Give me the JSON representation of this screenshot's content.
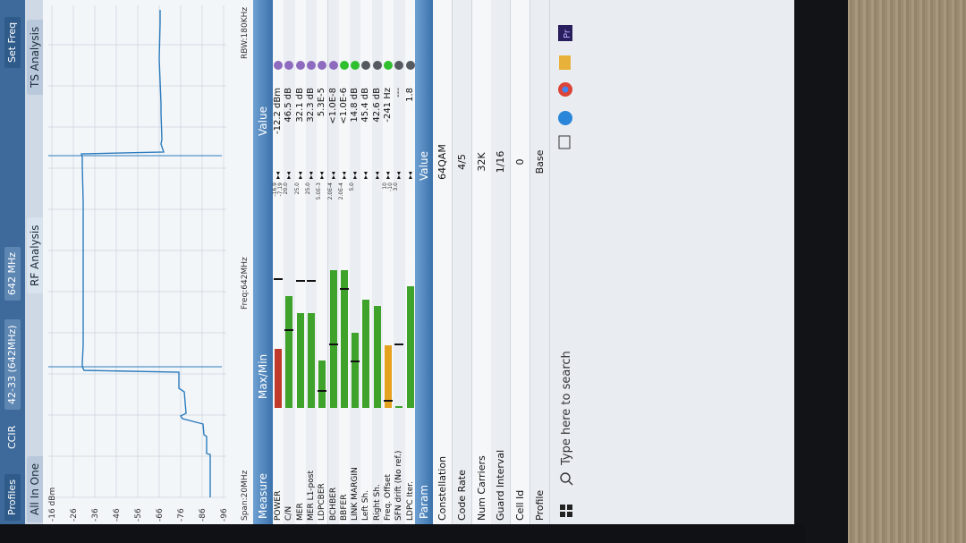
{
  "toolbar": {
    "profiles_label": "Profiles",
    "standard_label": "CCIR",
    "channel_label": "42-33 (642MHz)",
    "freq_label": "642 MHz",
    "set_freq_label": "Set Freq"
  },
  "tabs": [
    {
      "label": "All In One"
    },
    {
      "label": "RF Analysis"
    },
    {
      "label": "TS Analysis"
    }
  ],
  "spectrum": {
    "db_labels": [
      "-16 dBm",
      "-26",
      "-36",
      "-46",
      "-56",
      "-66",
      "-76",
      "-86",
      "-96"
    ],
    "span_label": "Span:20MHz",
    "freq_label": "Freq:642MHz",
    "rbw_label": "RBW:180KHz"
  },
  "measure_header": {
    "measure": "Measure",
    "maxmin": "Max/Min",
    "value": "Value"
  },
  "measures": [
    {
      "label": "POWER",
      "fill": 0.3,
      "color": "#c0392b",
      "tick": 0.65,
      "thr_hi": "-16.9",
      "thr_lo": "-7.19",
      "value": "-12.2 dBm",
      "status": "#8e6bbf"
    },
    {
      "label": "C/N",
      "fill": 0.57,
      "color": "#3fa22a",
      "tick": 0.39,
      "thr_hi": "20.0",
      "thr_lo": "",
      "value": "46.5 dB",
      "status": "#8e6bbf"
    },
    {
      "label": "MER",
      "fill": 0.48,
      "color": "#3fa22a",
      "tick": 0.64,
      "thr_hi": "25.0",
      "thr_lo": "",
      "value": "32.1 dB",
      "status": "#8e6bbf"
    },
    {
      "label": "MER L1-post",
      "fill": 0.48,
      "color": "#3fa22a",
      "tick": 0.64,
      "thr_hi": "25.0",
      "thr_lo": "",
      "value": "32.3 dB",
      "status": "#8e6bbf"
    },
    {
      "label": "LDPCBER",
      "fill": 0.24,
      "color": "#3fa22a",
      "tick": 0.08,
      "thr_hi": "5.0E-3",
      "thr_lo": "",
      "value": "5.3E-5",
      "status": "#8e6bbf"
    },
    {
      "label": "BCHBER",
      "fill": 0.7,
      "color": "#3fa22a",
      "tick": 0.32,
      "thr_hi": "2.0E-4",
      "thr_lo": "",
      "value": "<1.0E-8",
      "status": "#8e6bbf"
    },
    {
      "label": "BBFER",
      "fill": 0.7,
      "color": "#3fa22a",
      "tick": 0.6,
      "thr_hi": "2.0E-4",
      "thr_lo": "",
      "value": "<1.0E-6",
      "status": "#2fbf2f"
    },
    {
      "label": "LINK MARGIN",
      "fill": 0.38,
      "color": "#3fa22a",
      "tick": 0.23,
      "thr_hi": "5.0",
      "thr_lo": "",
      "value": "14.8 dB",
      "status": "#2fbf2f"
    },
    {
      "label": "Left Sh.",
      "fill": 0.55,
      "color": "#3fa22a",
      "tick": -1,
      "thr_hi": "",
      "thr_lo": "",
      "value": "45.4 dB",
      "status": "#555a60"
    },
    {
      "label": "Right Sh.",
      "fill": 0.52,
      "color": "#3fa22a",
      "tick": -1,
      "thr_hi": "",
      "thr_lo": "",
      "value": "42.6 dB",
      "status": "#555a60"
    },
    {
      "label": "Freq. Offset",
      "fill": 0.32,
      "color": "#e5a21e",
      "tick": 0.03,
      "thr_hi": "10",
      "thr_lo": "-10",
      "value": "-241 Hz",
      "status": "#2fbf2f"
    },
    {
      "label": "SFN drift (No ref.)",
      "fill": 0.01,
      "color": "#3fa22a",
      "tick": 0.32,
      "thr_hi": "3.0",
      "thr_lo": "",
      "value": "---",
      "status": "#555a60"
    },
    {
      "label": "LDPC Iter.",
      "fill": 0.62,
      "color": "#3fa22a",
      "tick": -1,
      "thr_hi": "",
      "thr_lo": "",
      "value": "1.8",
      "status": "#555a60"
    }
  ],
  "param_header": {
    "param": "Param",
    "value": "Value"
  },
  "params": [
    {
      "label": "Constellation",
      "value": "64QAM"
    },
    {
      "label": "Code Rate",
      "value": "4/5"
    },
    {
      "label": "Num Carriers",
      "value": "32K"
    },
    {
      "label": "Guard Interval",
      "value": "1/16"
    },
    {
      "label": "Cell Id",
      "value": "0"
    },
    {
      "label": "Profile",
      "value": "Base"
    }
  ],
  "taskbar": {
    "search_placeholder": "Type here to search",
    "app_label": "Pr"
  }
}
